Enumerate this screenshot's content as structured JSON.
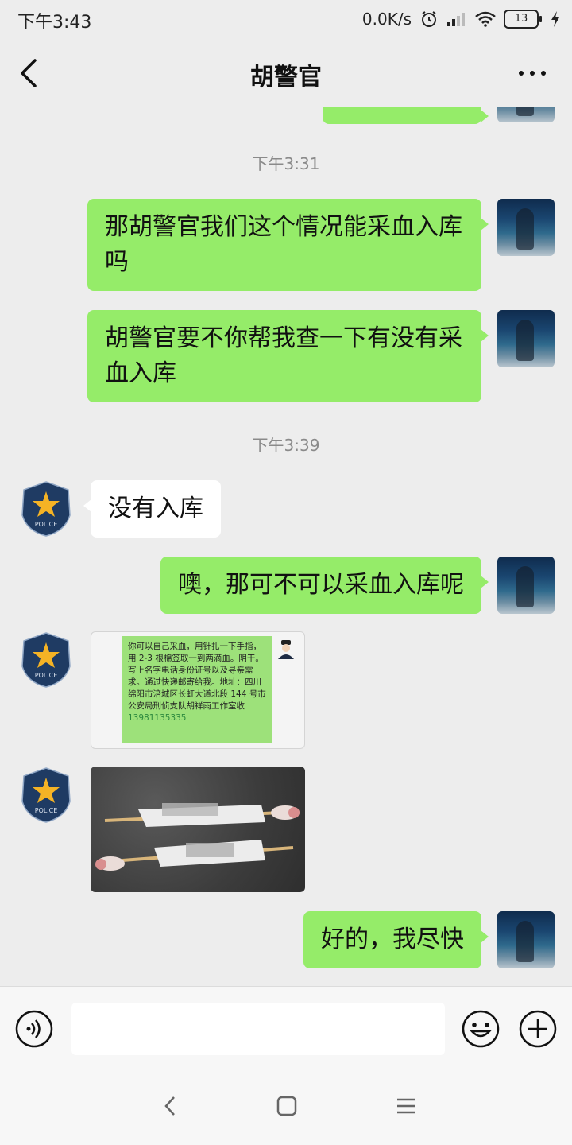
{
  "status_bar": {
    "time": "下午3:43",
    "speed": "0.0K/s",
    "battery": "13"
  },
  "header": {
    "title": "胡警官"
  },
  "icons": {
    "back": "back-chevron-icon",
    "more": "more-dots-icon",
    "voice": "voice-icon",
    "emoji": "emoji-icon",
    "add": "add-icon",
    "alarm": "alarm-icon",
    "signal": "signal-icon",
    "wifi": "wifi-icon",
    "charging": "charging-icon",
    "nav_back": "nav-back-icon",
    "nav_home": "nav-home-icon",
    "nav_menu": "nav-menu-icon"
  },
  "colors": {
    "my_bubble": "#95ec69",
    "their_bubble": "#ffffff",
    "background": "#ededed",
    "police_badge": "#1f3b63",
    "badge_star": "#f5b325"
  },
  "chat": {
    "timestamps": [
      "下午3:31",
      "下午3:39"
    ],
    "messages": [
      {
        "from": "me",
        "text": "那胡警官我们这个情况能采血入库\n吗"
      },
      {
        "from": "me",
        "text": "胡警官要不你帮我查一下有没有采\n血入库"
      },
      {
        "from": "them",
        "text": "没有入库"
      },
      {
        "from": "me",
        "text": "噢，那可不可以采血入库呢"
      },
      {
        "from": "them",
        "type": "image",
        "text": "你可以自己采血，用针扎一下手指，用 2-3 根棉签取一到两滴血。阴干。写上名字电话身份证号以及寻亲需求。通过快递邮寄给我。地址：四川绵阳市涪城区长虹大道北段 144 号市公安局刑侦支队胡祥雨工作室收",
        "phone": "13981135335"
      },
      {
        "from": "them",
        "type": "photo"
      },
      {
        "from": "me",
        "text": "好的，我尽快"
      }
    ],
    "police_badge_text": "POLICE"
  },
  "input": {
    "value": "",
    "placeholder": ""
  }
}
